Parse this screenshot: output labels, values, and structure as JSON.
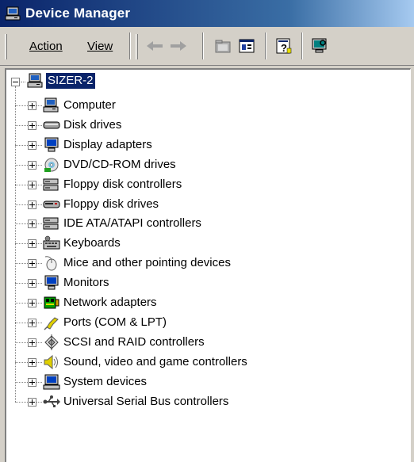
{
  "window": {
    "title": "Device Manager"
  },
  "menu": {
    "action_label": "Action",
    "view_label": "View"
  },
  "toolbar": {
    "buttons": [
      "back-icon",
      "forward-icon",
      "up-folder-icon",
      "properties-view-icon",
      "help-icon",
      "monitor-icon"
    ]
  },
  "tree": {
    "root": {
      "label": "SIZER-2",
      "icon": "computer-icon"
    },
    "categories": [
      {
        "label": "Computer",
        "icon": "computer-icon"
      },
      {
        "label": "Disk drives",
        "icon": "disk-drive-icon"
      },
      {
        "label": "Display adapters",
        "icon": "display-adapter-icon"
      },
      {
        "label": "DVD/CD-ROM drives",
        "icon": "cdrom-icon"
      },
      {
        "label": "Floppy disk controllers",
        "icon": "controller-icon"
      },
      {
        "label": "Floppy disk drives",
        "icon": "floppy-drive-icon"
      },
      {
        "label": "IDE ATA/ATAPI controllers",
        "icon": "controller-icon"
      },
      {
        "label": "Keyboards",
        "icon": "keyboard-icon"
      },
      {
        "label": "Mice and other pointing devices",
        "icon": "mouse-icon"
      },
      {
        "label": "Monitors",
        "icon": "monitor-icon"
      },
      {
        "label": "Network adapters",
        "icon": "network-adapter-icon"
      },
      {
        "label": "Ports (COM & LPT)",
        "icon": "port-icon"
      },
      {
        "label": "SCSI and RAID controllers",
        "icon": "scsi-icon"
      },
      {
        "label": "Sound, video and game controllers",
        "icon": "sound-icon"
      },
      {
        "label": "System devices",
        "icon": "system-devices-icon"
      },
      {
        "label": "Universal Serial Bus controllers",
        "icon": "usb-icon"
      }
    ]
  },
  "colors": {
    "titlebar_start": "#0a246a",
    "titlebar_end": "#a6caf0",
    "selection": "#0a246a",
    "face": "#d4d0c8"
  }
}
